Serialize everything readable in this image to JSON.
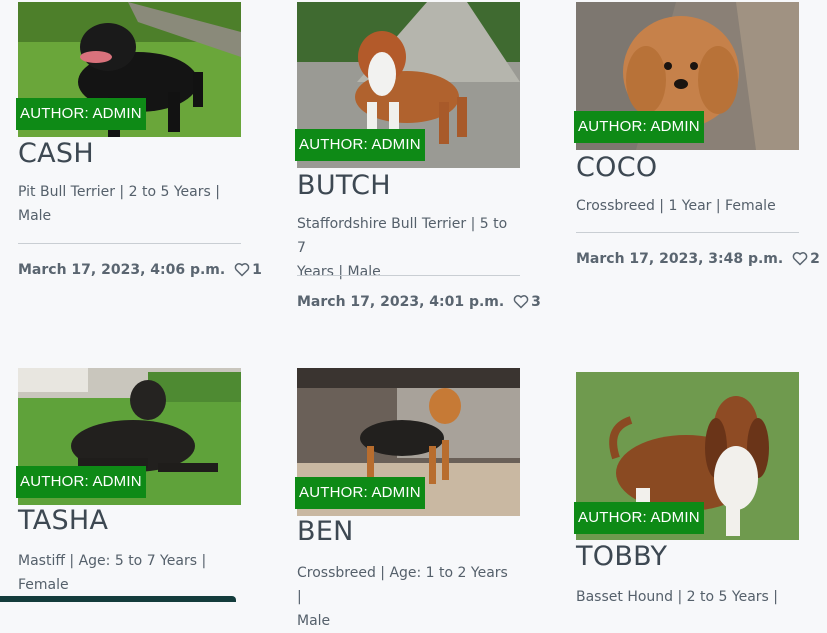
{
  "posts": [
    {
      "id": "cash",
      "author": "AUTHOR: ADMIN",
      "name": "CASH",
      "desc_line1": "Pit Bull Terrier | 2 to 5 Years |",
      "desc_line2": "Male",
      "date": "March 17, 2023, 4:06 p.m.",
      "likes": "1"
    },
    {
      "id": "butch",
      "author": "AUTHOR: ADMIN",
      "name": "BUTCH",
      "desc_line1": "Staffordshire Bull Terrier | 5 to 7",
      "desc_line2": "Years | Male",
      "date": "March 17, 2023, 4:01 p.m.",
      "likes": "3"
    },
    {
      "id": "coco",
      "author": "AUTHOR: ADMIN",
      "name": "COCO",
      "desc_line1": "Crossbreed | 1 Year | Female",
      "desc_line2": "",
      "date": "March 17, 2023, 3:48 p.m.",
      "likes": "2"
    },
    {
      "id": "tasha",
      "author": "AUTHOR: ADMIN",
      "name": "TASHA",
      "desc_line1": "Mastiff | Age: 5 to 7 Years |",
      "desc_line2": "Female"
    },
    {
      "id": "ben",
      "author": "AUTHOR: ADMIN",
      "name": "BEN",
      "desc_line1": "Crossbreed | Age: 1 to 2 Years |",
      "desc_line2": "Male"
    },
    {
      "id": "tobby",
      "author": "AUTHOR: ADMIN",
      "name": "TOBBY",
      "desc_line1": "Basset Hound | 2 to 5 Years |"
    }
  ],
  "icons": {
    "like": "heart-outline-icon"
  },
  "colors": {
    "badge": "#0e8a16",
    "title": "#3d4852",
    "background": "#f7f8fa"
  }
}
